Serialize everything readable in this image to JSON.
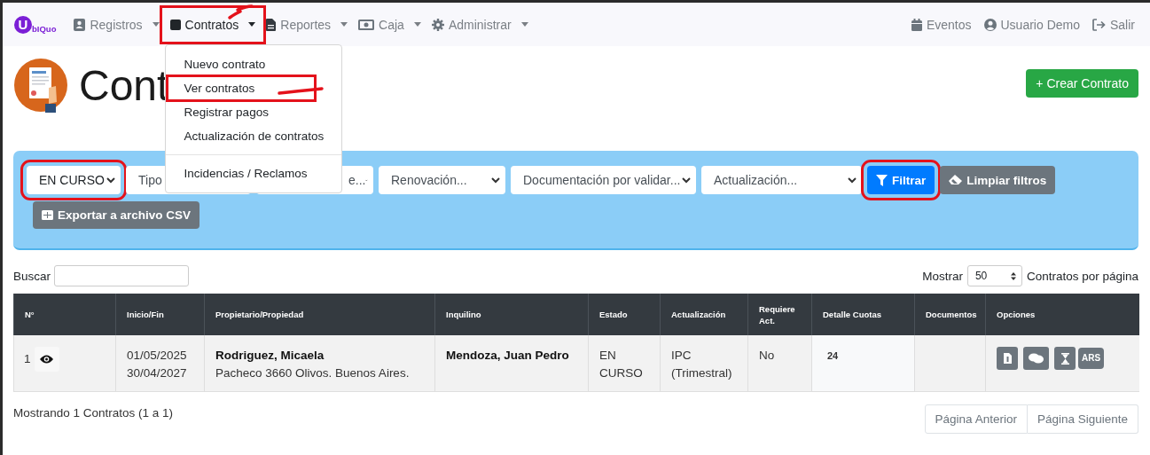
{
  "navbar": {
    "logo": "bIQuo",
    "logo_initial": "U",
    "menus": [
      {
        "label": "Registros",
        "selected": false,
        "highlighted": false
      },
      {
        "label": "Contratos",
        "selected": true,
        "highlighted": true
      },
      {
        "label": "Reportes",
        "selected": false,
        "highlighted": false
      },
      {
        "label": "Caja",
        "selected": false,
        "highlighted": false
      },
      {
        "label": "Administrar",
        "selected": false,
        "highlighted": false
      }
    ],
    "right": [
      {
        "label": "Eventos"
      },
      {
        "label": "Usuario Demo"
      },
      {
        "label": "Salir"
      }
    ]
  },
  "dropdown": {
    "groups": [
      [
        {
          "label": "Nuevo contrato",
          "highlighted": false
        },
        {
          "label": "Ver contratos",
          "highlighted": true
        },
        {
          "label": "Registrar pagos",
          "highlighted": false
        },
        {
          "label": "Actualización de contratos",
          "highlighted": false
        }
      ],
      [
        {
          "label": "Incidencias / Reclamos",
          "highlighted": false
        }
      ]
    ]
  },
  "header": {
    "title": "Cont",
    "create_button": "+ Crear Contrato"
  },
  "filters": {
    "selects": [
      {
        "value": "EN CURSO",
        "highlighted": true
      },
      {
        "value": "Tipo"
      },
      {
        "value": "e..."
      },
      {
        "value": "Renovación...",
        "highlighted": false
      },
      {
        "value": "Documentación por validar...",
        "highlighted": false
      },
      {
        "value": "Actualización...",
        "highlighted": false
      }
    ],
    "filter_button": {
      "label": "Filtrar",
      "highlighted": true
    },
    "clear_button": "Limpiar filtros",
    "export_button": "Exportar a archivo CSV"
  },
  "search": {
    "label": "Buscar",
    "show_label": "Mostrar",
    "page_size": "50",
    "per_page_label": "Contratos por página"
  },
  "table": {
    "columns": [
      "N°",
      "Inicio/Fin",
      "Propietario/Propiedad",
      "Inquilino",
      "Estado",
      "Actualización",
      "Requiere Act.",
      "Detalle Cuotas",
      "Documentos",
      "Opciones"
    ],
    "rows": [
      {
        "number": "1",
        "start": "01/05/2025",
        "end": "30/04/2027",
        "owner": "Rodriguez, Micaela",
        "property": "Pacheco 3660 Olivos. Buenos Aires.",
        "tenant": "Mendoza, Juan Pedro",
        "status": "EN CURSO",
        "update": "IPC (Trimestral)",
        "requires_update": "No",
        "installments": "24",
        "currency": "ARS"
      }
    ]
  },
  "footer": {
    "summary": "Mostrando 1 Contratos (1 a 1)",
    "pages": [
      "Página Anterior",
      "Página Siguiente"
    ]
  }
}
